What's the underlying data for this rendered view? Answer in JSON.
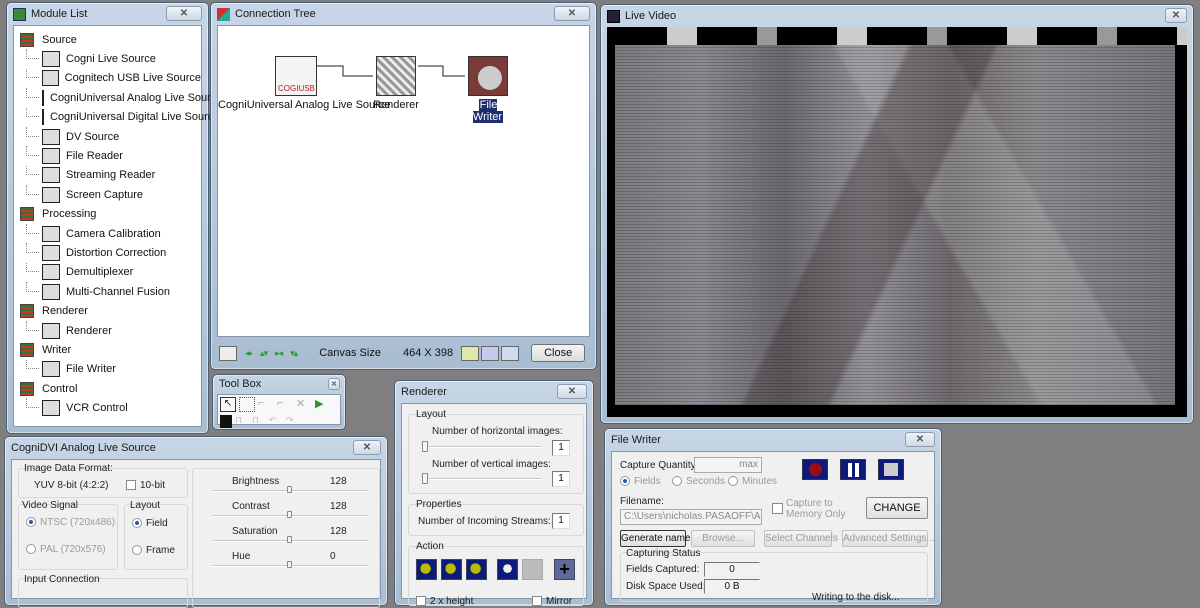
{
  "module_list": {
    "title": "Module List",
    "close": "✕",
    "groups": [
      {
        "label": "Source",
        "items": [
          "Cogni Live Source",
          "Cognitech USB  Live Source",
          "CogniUniversal Analog Live Source",
          "CogniUniversal Digital Live Source",
          "DV Source",
          "File Reader",
          "Streaming Reader",
          "Screen Capture"
        ]
      },
      {
        "label": "Processing",
        "items": [
          "Camera Calibration",
          "Distortion Correction",
          "Demultiplexer",
          "Multi-Channel Fusion"
        ]
      },
      {
        "label": "Renderer",
        "items": [
          "Renderer"
        ]
      },
      {
        "label": "Writer",
        "items": [
          "File Writer"
        ]
      },
      {
        "label": "Control",
        "items": [
          "VCR Control"
        ]
      }
    ]
  },
  "connection_tree": {
    "title": "Connection Tree",
    "close": "✕",
    "nodes": [
      {
        "label": "CogniUniversal Analog Live Source",
        "icon_text": "COGIUSB"
      },
      {
        "label": "Renderer"
      },
      {
        "label": "File Writer",
        "selected": true
      }
    ],
    "canvas_size_label": "Canvas Size",
    "canvas_size_value": "464 X 398",
    "close_button": "Close"
  },
  "toolbox": {
    "title": "Tool Box",
    "close": "✕"
  },
  "live_video": {
    "title": "Live Video",
    "close": "✕"
  },
  "analog_source": {
    "title": "CogniDVI Analog Live Source",
    "close": "✕",
    "image_format_label": "Image Data Format:",
    "image_format_value": "YUV 8-bit (4:2:2)",
    "ten_bit_label": "10-bit",
    "video_signal_label": "Video Signal",
    "ntsc_label": "NTSC (720x486)",
    "pal_label": "PAL (720x576)",
    "layout_label": "Layout",
    "field_label": "Field",
    "frame_label": "Frame",
    "input_connection_label": "Input Connection",
    "sliders": [
      {
        "label": "Brightness",
        "value": "128",
        "fraction": 0.5
      },
      {
        "label": "Contrast",
        "value": "128",
        "fraction": 0.5
      },
      {
        "label": "Saturation",
        "value": "128",
        "fraction": 0.5
      },
      {
        "label": "Hue",
        "value": "0",
        "fraction": 0.5
      }
    ]
  },
  "renderer": {
    "title": "Renderer",
    "close": "✕",
    "layout_label": "Layout",
    "horizontal_label": "Number of horizontal images:",
    "horizontal_value": "1",
    "vertical_label": "Number of vertical images:",
    "vertical_value": "1",
    "properties_label": "Properties",
    "streams_label": "Number of Incoming Streams:",
    "streams_value": "1",
    "action_label": "Action",
    "double_height_label": "2 x height",
    "mirror_label": "Mirror"
  },
  "file_writer": {
    "title": "File Writer",
    "close": "✕",
    "capture_quantity_label": "Capture Quantity:",
    "capture_quantity_value": "max",
    "fields_label": "Fields",
    "seconds_label": "Seconds",
    "minutes_label": "Minutes",
    "filename_label": "Filename:",
    "filename_value": "C:\\Users\\nicholas.PASAOFF\\AppD",
    "capture_memory_label": "Capture to Memory Only",
    "change_button": "CHANGE",
    "generate_name_button": "Generate name",
    "browse_button": "Browse...",
    "select_channels_button": "Select Channels",
    "advanced_settings_button": "Advanced Settings...",
    "capturing_status_label": "Capturing Status",
    "fields_captured_label": "Fields Captured:",
    "fields_captured_value": "0",
    "disk_space_label": "Disk Space Used:",
    "disk_space_value": "0 B",
    "status_text": "Writing to the disk..."
  }
}
